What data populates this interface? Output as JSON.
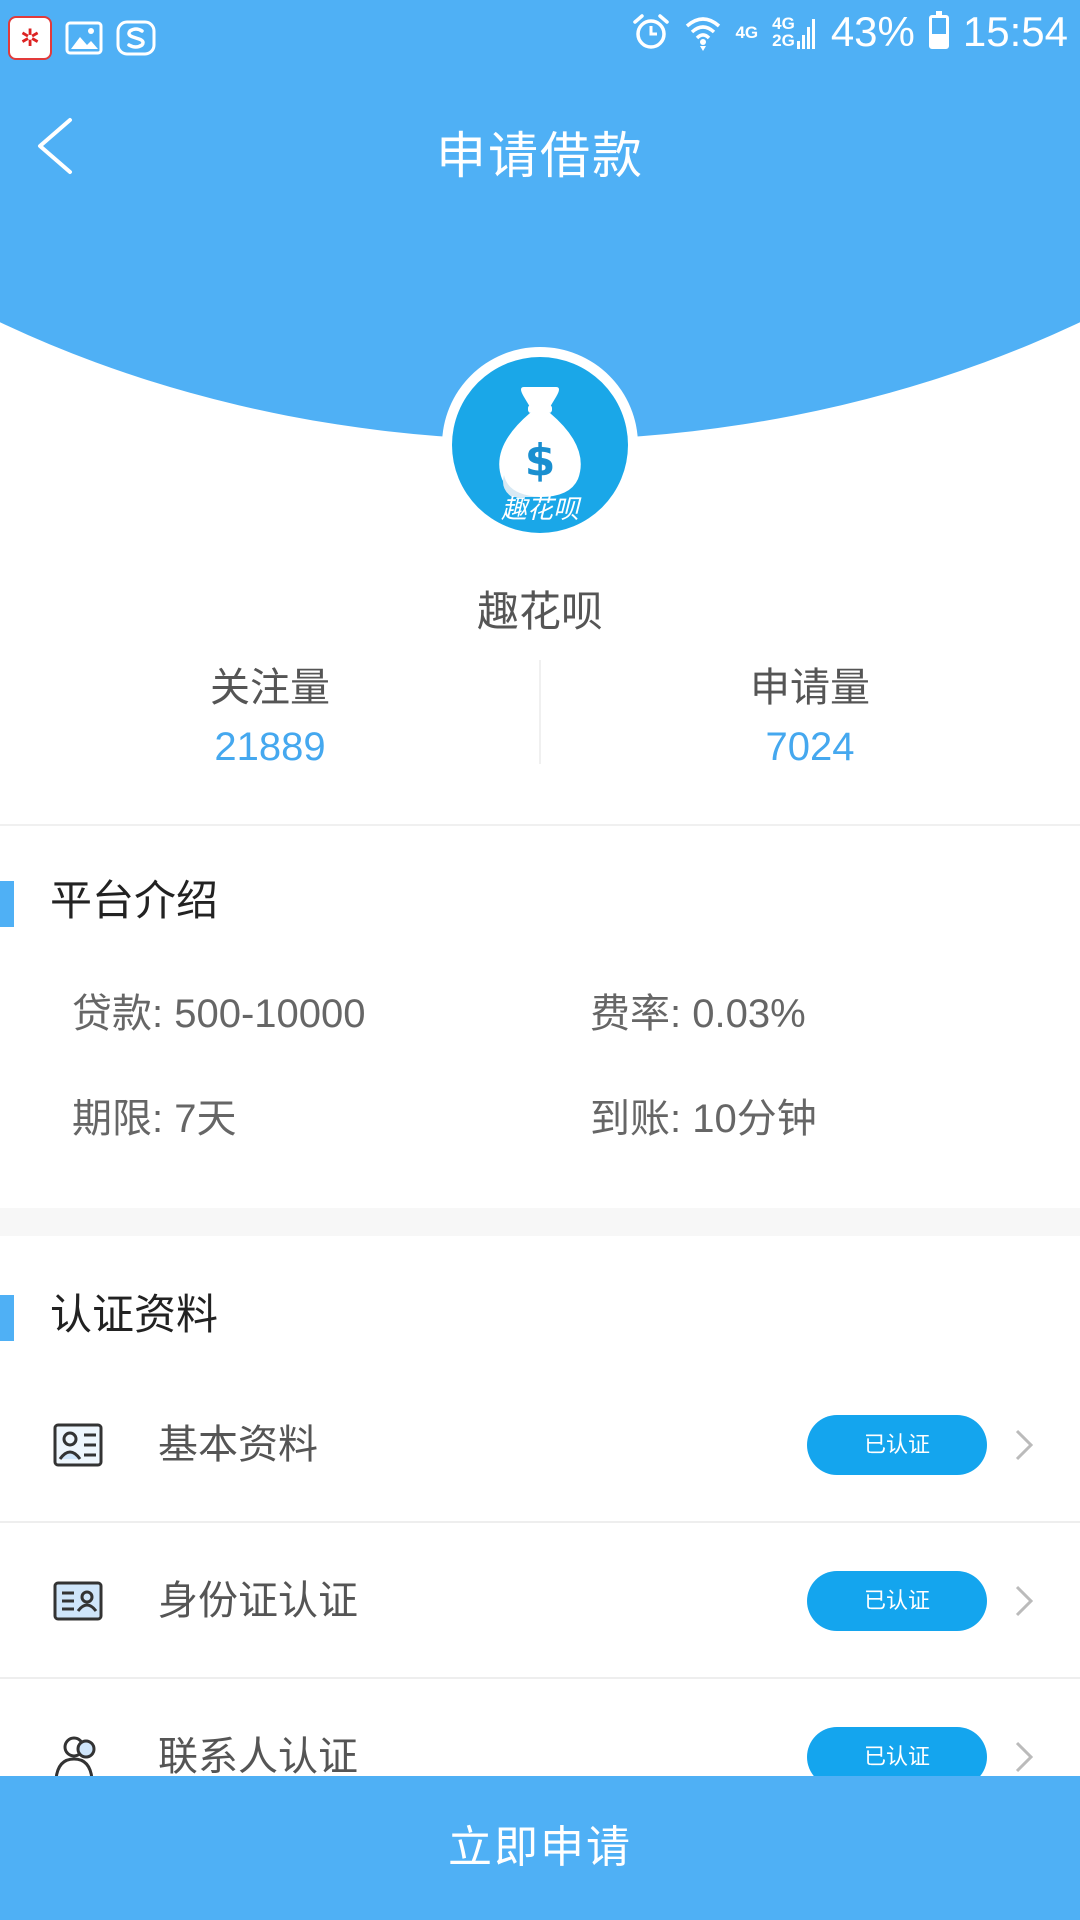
{
  "status_bar": {
    "network_top": "4G",
    "network_dual_top": "4G",
    "network_dual_bottom": "2G",
    "battery_percent": "43%",
    "battery_level": 0.43,
    "time": "15:54",
    "notification_icons": [
      "app-icon",
      "gallery-icon",
      "sogou-input-icon"
    ],
    "system_icons": [
      "alarm-icon",
      "wifi-icon",
      "signal-icon",
      "battery-icon"
    ]
  },
  "nav": {
    "back_icon": "chevron-left-icon",
    "title": "申请借款"
  },
  "app": {
    "logo_text": "趣花呗",
    "name": "趣花呗",
    "logo_icon": "money-bag-icon"
  },
  "stats": {
    "follow": {
      "label": "关注量",
      "value": "21889"
    },
    "apply": {
      "label": "申请量",
      "value": "7024"
    }
  },
  "platform": {
    "title": "平台介绍",
    "loan": "贷款: 500-10000",
    "rate": "费率: 0.03%",
    "term": "期限: 7天",
    "arrival": "到账: 10分钟"
  },
  "certification": {
    "title": "认证资料",
    "items": [
      {
        "label": "基本资料",
        "status": "已认证",
        "icon": "profile-card-icon"
      },
      {
        "label": "身份证认证",
        "status": "已认证",
        "icon": "id-card-icon"
      },
      {
        "label": "联系人认证",
        "status": "已认证",
        "icon": "contacts-icon"
      }
    ]
  },
  "actions": {
    "apply_label": "立即申请"
  },
  "colors": {
    "primary": "#4fb0f5",
    "badge": "#14a5ee",
    "accent_text": "#45a8ef"
  }
}
